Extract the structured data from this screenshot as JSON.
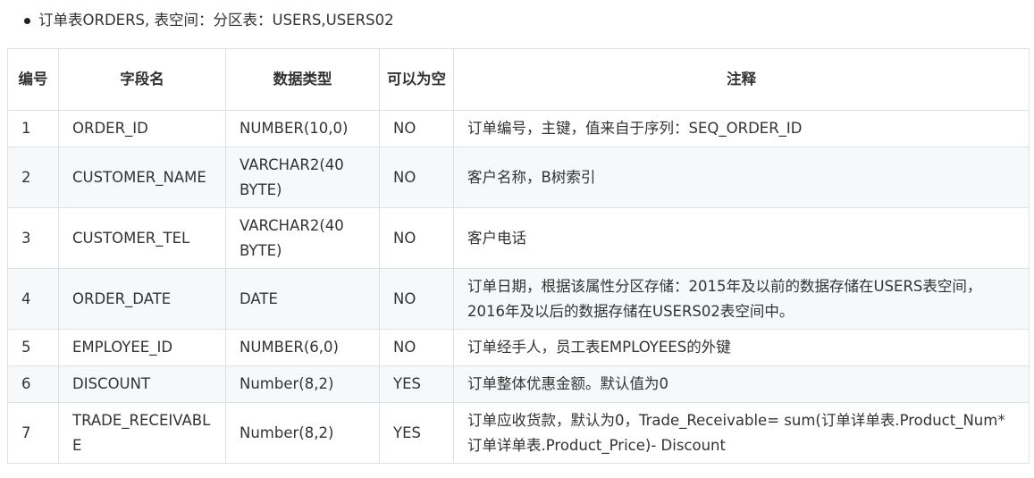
{
  "intro": {
    "text": "订单表ORDERS, 表空间：分区表：USERS,USERS02"
  },
  "table": {
    "headers": [
      "编号",
      "字段名",
      "数据类型",
      "可以为空",
      "注释"
    ],
    "rows": [
      {
        "no": "1",
        "field": "ORDER_ID",
        "type": "NUMBER(10,0)",
        "nullable": "NO",
        "comment": "订单编号，主键，值来自于序列：SEQ_ORDER_ID"
      },
      {
        "no": "2",
        "field": "CUSTOMER_NAME",
        "type": "VARCHAR2(40 BYTE)",
        "nullable": "NO",
        "comment": "客户名称，B树索引"
      },
      {
        "no": "3",
        "field": "CUSTOMER_TEL",
        "type": "VARCHAR2(40 BYTE)",
        "nullable": "NO",
        "comment": "客户电话"
      },
      {
        "no": "4",
        "field": "ORDER_DATE",
        "type": "DATE",
        "nullable": "NO",
        "comment": "订单日期，根据该属性分区存储：2015年及以前的数据存储在USERS表空间，2016年及以后的数据存储在USERS02表空间中。"
      },
      {
        "no": "5",
        "field": "EMPLOYEE_ID",
        "type": "NUMBER(6,0)",
        "nullable": "NO",
        "comment": "订单经手人，员工表EMPLOYEES的外键"
      },
      {
        "no": "6",
        "field": "DISCOUNT",
        "type": "Number(8,2)",
        "nullable": "YES",
        "comment": "订单整体优惠金额。默认值为0"
      },
      {
        "no": "7",
        "field": "TRADE_RECEIVABLE",
        "type": "Number(8,2)",
        "nullable": "YES",
        "comment": "订单应收货款，默认为0，Trade_Receivable= sum(订单详单表.Product_Num*订单详单表.Product_Price)- Discount"
      }
    ]
  }
}
